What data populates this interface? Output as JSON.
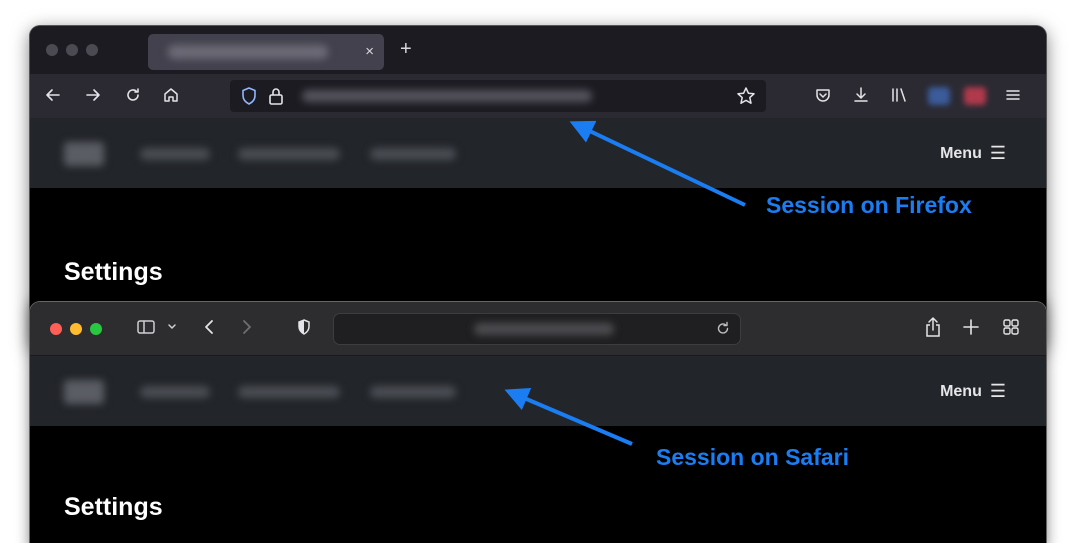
{
  "firefox": {
    "tab": {
      "close_glyph": "×"
    },
    "new_tab_glyph": "+",
    "toolbar_icons": [
      "back-icon",
      "forward-icon",
      "reload-icon",
      "home-icon",
      "shield-icon",
      "lock-icon",
      "star-icon",
      "pocket-icon",
      "download-icon",
      "library-icon",
      "hamburger-menu-icon"
    ],
    "site_header": {
      "menu_label": "Menu",
      "menu_glyph": "☰"
    },
    "page_heading": "Settings"
  },
  "safari": {
    "traffic_colors": [
      "#ff5f57",
      "#febc2e",
      "#28c840"
    ],
    "toolbar_icons": [
      "sidebar-icon",
      "chevron-down-icon",
      "back-icon",
      "forward-icon",
      "shield-icon",
      "reload-icon",
      "share-icon",
      "new-tab-icon",
      "tab-overview-icon"
    ],
    "site_header": {
      "menu_label": "Menu",
      "menu_glyph": "☰"
    },
    "page_heading": "Settings"
  },
  "annotations": {
    "firefox_label": "Session on Firefox",
    "safari_label": "Session on Safari",
    "color": "#1a7df2"
  }
}
